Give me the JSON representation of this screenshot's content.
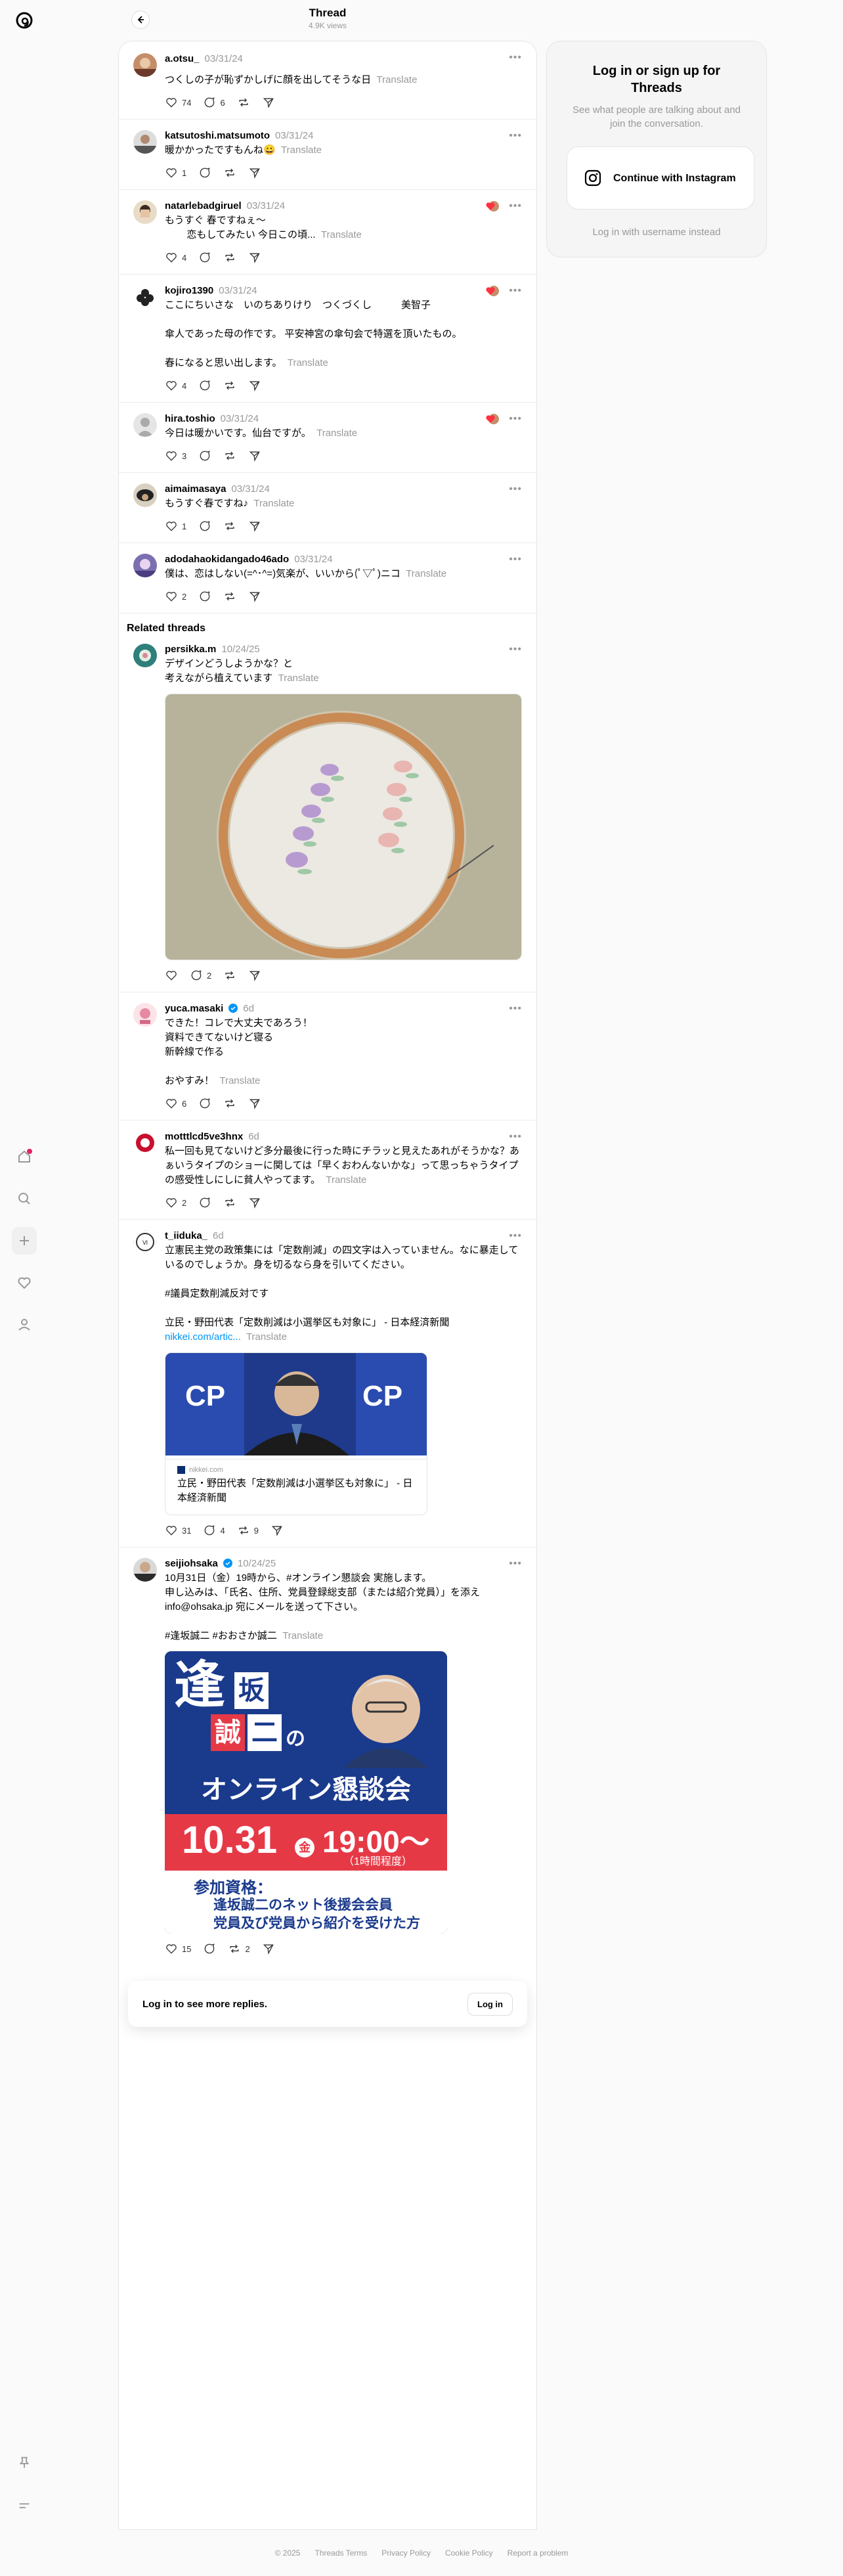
{
  "header": {
    "title": "Thread",
    "views": "4.9K views"
  },
  "posts": [
    {
      "user": "a.otsu_",
      "time": "03/31/24",
      "text": "つくしの子が恥ずかしげに顔を出してそうな日",
      "translate": "Translate",
      "likes": "74",
      "replies": "6",
      "reposts": ""
    },
    {
      "user": "katsutoshi.matsumoto",
      "time": "03/31/24",
      "text": "暖かかったですもんね😀",
      "translate": "Translate",
      "likes": "1",
      "replies": "",
      "reposts": ""
    },
    {
      "user": "natarlebadgiruel",
      "time": "03/31/24",
      "text": "もうすぐ 春ですねぇ〜\n        恋もしてみたい 今日この頃...",
      "translate": "Translate",
      "likes": "4",
      "replies": "",
      "reposts": ""
    },
    {
      "user": "kojiro1390",
      "time": "03/31/24",
      "text": "ここにちいさな　いのちありけり　つくづくし　　　美智子\n\n傘人であった母の作です。 平安神宮の傘句会で特選を頂いたもの。\n\n春になると思い出します。",
      "translate": "Translate",
      "likes": "4",
      "replies": "",
      "reposts": ""
    },
    {
      "user": "hira.toshio",
      "time": "03/31/24",
      "text": "今日は暖かいです。仙台ですが。",
      "translate": "Translate",
      "likes": "3",
      "replies": "",
      "reposts": ""
    },
    {
      "user": "aimaimasaya",
      "time": "03/31/24",
      "text": "もうすぐ春ですね♪",
      "translate": "Translate",
      "likes": "1",
      "replies": "",
      "reposts": ""
    },
    {
      "user": "adodahaokidangado46ado",
      "time": "03/31/24",
      "text": "僕は、恋はしない(=^･^=)気楽が、いいから(ﾟ▽ﾟ)ニコ",
      "translate": "Translate",
      "likes": "2",
      "replies": "",
      "reposts": ""
    }
  ],
  "related": {
    "title": "Related threads",
    "posts": [
      {
        "user": "persikka.m",
        "time": "10/24/25",
        "text": "デザインどうしようかな？と\n考えながら植えています",
        "translate": "Translate",
        "likes": "",
        "replies": "2",
        "reposts": ""
      },
      {
        "user": "yuca.masaki",
        "time": "6d",
        "text": "できた！コレで大丈夫であろう！\n資料できてないけど寝る\n新幹線で作る\n\nおやすみ！",
        "translate": "Translate",
        "likes": "6",
        "replies": "",
        "reposts": ""
      },
      {
        "user": "motttlcd5ve3hnx",
        "time": "6d",
        "text": "私一回も見てないけど多分最後に行った時にチラッと見えたあれがそうかな？あぁいうタイプのショーに関しては「早くおわんないかな」って思っちゃうタイプの感受性しにしに貧人やってます。",
        "translate": "Translate",
        "likes": "2",
        "replies": "",
        "reposts": ""
      },
      {
        "user": "t_iiduka_",
        "time": "6d",
        "text": "立憲民主党の政策集には「定数削減」の四文字は入っていません。なに暴走しているのでしょうか。身を切るなら身を引いてください。\n\n#議員定数削減反対です\n\n立民・野田代表「定数削減は小選挙区も対象に」 - 日本経済新聞",
        "link": "nikkei.com/artic...",
        "translate": "Translate",
        "likes": "31",
        "replies": "4",
        "reposts": "9",
        "card": {
          "domain": "nikkei.com",
          "title": "立民・野田代表「定数削減は小選挙区も対象に」 - 日本経済新聞"
        }
      },
      {
        "user": "seijiohsaka",
        "time": "10/24/25",
        "text": "10月31日（金）19時から、#オンライン懇談会 実施します。\n申し込みは、「氏名、住所、党員登録総支部（または紹介党員）」を添えinfo@ohsaka.jp 宛にメールを送って下さい。\n\n#逢坂誠二 #おおさか誠二",
        "translate": "Translate",
        "likes": "15",
        "replies": "",
        "reposts": "2",
        "poster": {
          "name1": "逢",
          "name2": "坂",
          "name3": "誠",
          "name4": "二",
          "no": "の",
          "title": "オンライン懇談会",
          "date": "10.31",
          "dow": "金",
          "time": "19:00〜",
          "duration": "（1時間程度）",
          "qual_label": "参加資格：",
          "qual1": "逢坂誠二のネット後援会会員",
          "qual2": "党員及び党員から紹介を受けた方"
        }
      }
    ]
  },
  "login_bar": {
    "text": "Log in to see more replies.",
    "button": "Log in"
  },
  "login_card": {
    "title": "Log in or sign up for Threads",
    "subtitle": "See what people are talking about and join the conversation.",
    "ig_button": "Continue with Instagram",
    "alt": "Log in with username instead"
  },
  "footer": [
    "© 2025",
    "Threads Terms",
    "Privacy Policy",
    "Cookie Policy",
    "Report a problem"
  ],
  "colors": {
    "accent": "#0095f6",
    "muted": "#999999",
    "notification": "#e0245e"
  }
}
